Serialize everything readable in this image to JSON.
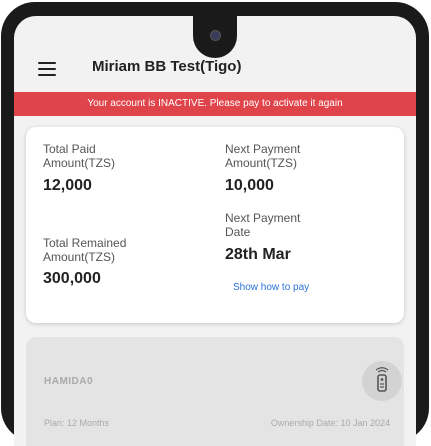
{
  "header": {
    "title": "Miriam BB Test(Tigo)"
  },
  "banner": {
    "text": "Your account is INACTIVE. Please pay to activate it again"
  },
  "summary": {
    "total_paid_label": "Total Paid Amount(TZS)",
    "total_paid_value": "12,000",
    "next_payment_amount_label": "Next Payment Amount(TZS)",
    "next_payment_amount_value": "10,000",
    "next_payment_date_label": "Next Payment Date",
    "next_payment_date_value": "28th Mar",
    "total_remained_label": "Total Remained Amount(TZS)",
    "total_remained_value": "300,000",
    "show_how_label": "Show how to pay"
  },
  "device": {
    "name": "HAMIDA0",
    "plan": "Plan: 12 Months",
    "ownership_date": "Ownership Date: 10 Jan 2024",
    "icon": "remote-icon"
  },
  "colors": {
    "banner": "#e0444b",
    "link": "#2a73d9"
  }
}
